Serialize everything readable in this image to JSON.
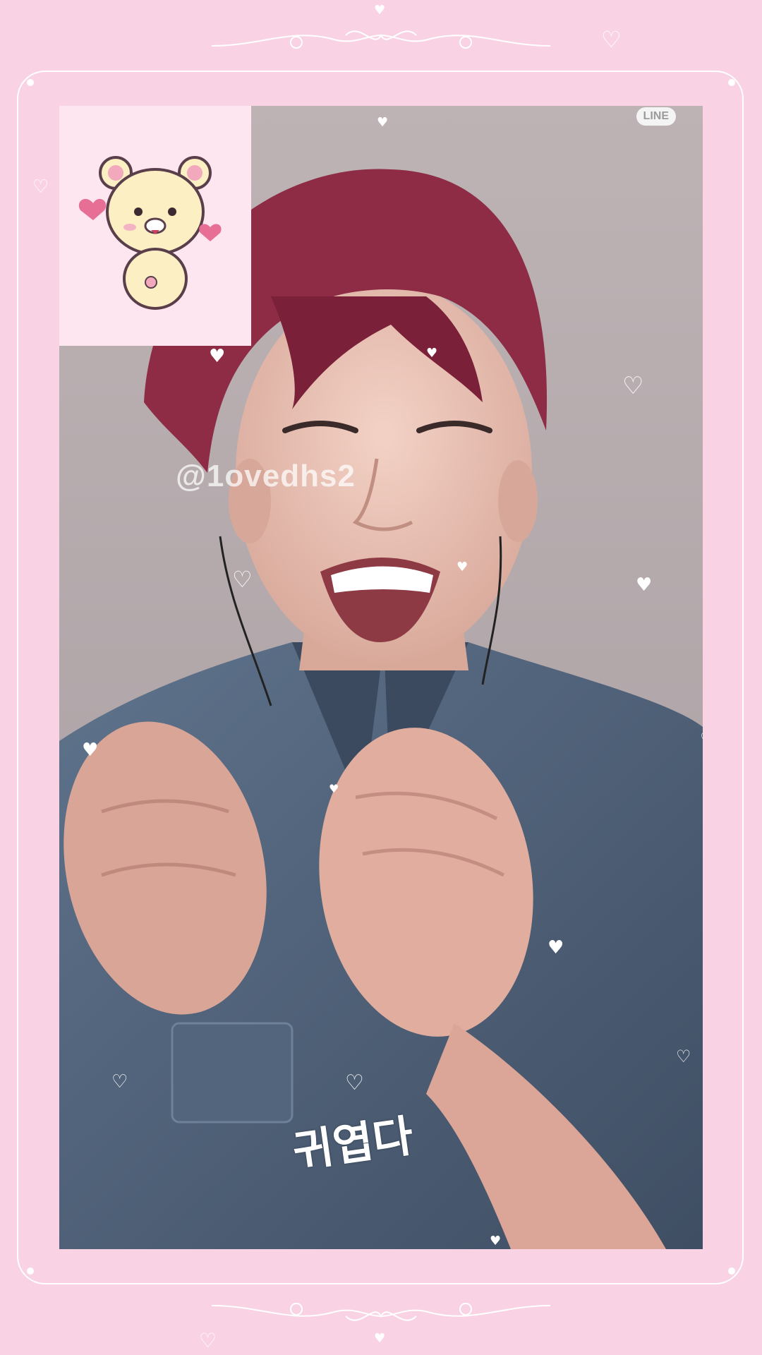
{
  "watermark": {
    "text": "@1ovedhs2"
  },
  "logo": {
    "text": "LINE"
  },
  "caption": {
    "text": "귀엽다"
  },
  "sticker": {
    "icon": "bear-character-icon"
  },
  "colors": {
    "background": "#f9d3e4",
    "frame_line": "#ffffff",
    "sticker_bg": "#fde6ef",
    "hair": "#8e2b45",
    "shirt": "#4d5f78"
  },
  "decorations": {
    "heart_glyph_filled": "♥",
    "heart_glyph_outline": "♡"
  }
}
